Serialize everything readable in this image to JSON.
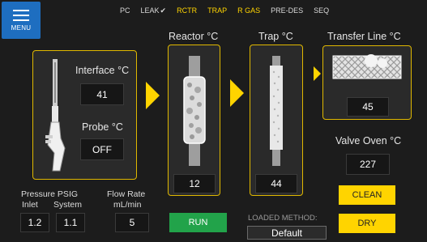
{
  "nav": {
    "menu_label": "MENU",
    "steps": [
      {
        "label": "PC",
        "state": "normal"
      },
      {
        "label": "LEAK",
        "state": "normal",
        "check": "✔"
      },
      {
        "label": "RCTR",
        "state": "active"
      },
      {
        "label": "TRAP",
        "state": "gas"
      },
      {
        "label": "R GAS",
        "state": "active"
      },
      {
        "label": "PRE-DES",
        "state": "normal"
      },
      {
        "label": "SEQ",
        "state": "normal"
      }
    ]
  },
  "probe_panel": {
    "interface_label": "Interface °C",
    "interface_value": "41",
    "probe_label": "Probe °C",
    "probe_value": "OFF"
  },
  "reactor": {
    "label": "Reactor °C",
    "value": "12"
  },
  "trap": {
    "label": "Trap °C",
    "value": "44"
  },
  "transfer_line": {
    "label": "Transfer Line °C",
    "value": "45"
  },
  "valve_oven": {
    "label": "Valve Oven °C",
    "value": "227"
  },
  "pressure": {
    "label": "Pressure PSIG",
    "inlet_label": "Inlet",
    "inlet_value": "1.2",
    "system_label": "System",
    "system_value": "1.1"
  },
  "flow": {
    "label_line1": "Flow Rate",
    "label_line2": "mL/min",
    "value": "5"
  },
  "buttons": {
    "run": "RUN",
    "clean": "CLEAN",
    "dry": "DRY"
  },
  "method": {
    "label": "LOADED METHOD:",
    "value": "Default"
  },
  "colors": {
    "accent": "#ffd400",
    "menu": "#1e6ec0",
    "run": "#22a34a",
    "background": "#1c1c1c"
  }
}
